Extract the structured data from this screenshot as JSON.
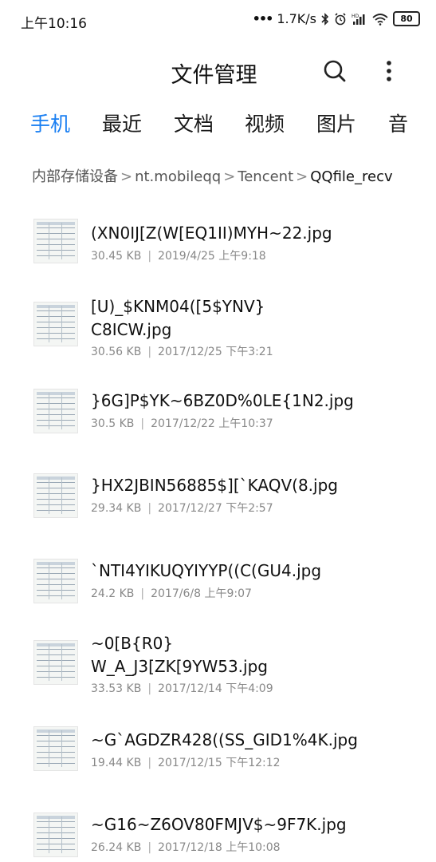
{
  "status_bar": {
    "time": "上午10:16",
    "network_speed": "1.7K/s",
    "battery": "80",
    "icons": [
      "dots-icon",
      "bluetooth-icon",
      "alarm-icon",
      "hd-signal-icon",
      "wifi-icon",
      "battery-icon"
    ]
  },
  "app_bar": {
    "title": "文件管理",
    "search_icon": "search-icon",
    "more_icon": "more-vertical-icon"
  },
  "tabs": [
    {
      "label": "手机",
      "active": true
    },
    {
      "label": "最近",
      "active": false
    },
    {
      "label": "文档",
      "active": false
    },
    {
      "label": "视频",
      "active": false
    },
    {
      "label": "图片",
      "active": false
    },
    {
      "label": "音",
      "active": false
    }
  ],
  "breadcrumb": {
    "segments": [
      "内部存储设备",
      "nt.mobileqq",
      "Tencent"
    ],
    "current": "QQfile_recv",
    "separator": ">"
  },
  "accent_color": "#1a7ff2",
  "files": [
    {
      "name": "(XN0IJ[Z(W[EQ1II)MYH~22.jpg",
      "size": "30.45 KB",
      "date": "2019/4/25 上午9:18"
    },
    {
      "name": "[U)_$KNM04([5$YNV}C8ICW.jpg",
      "name_line1": "[U)_$KNM04([5$YNV}",
      "name_line2": "C8ICW.jpg",
      "size": "30.56 KB",
      "date": "2017/12/25 下午3:21"
    },
    {
      "name": "}6G]P$YK~6BZ0D%0LE{1N2.jpg",
      "size": "30.5 KB",
      "date": "2017/12/22 上午10:37"
    },
    {
      "name": "}HX2JBIN56885$][`KAQV(8.jpg",
      "size": "29.34 KB",
      "date": "2017/12/27 下午2:57"
    },
    {
      "name": "`NTI4YIKUQYIYYP((C(GU4.jpg",
      "size": "24.2 KB",
      "date": "2017/6/8 上午9:07"
    },
    {
      "name": "~0[B{R0}W_A_J3[ZK[9YW53.jpg",
      "name_line1": "~0[B{R0}",
      "name_line2": "W_A_J3[ZK[9YW53.jpg",
      "size": "33.53 KB",
      "date": "2017/12/14 下午4:09"
    },
    {
      "name": "~G`AGDZR428((SS_GID1%4K.jpg",
      "size": "19.44 KB",
      "date": "2017/12/15 下午12:12"
    },
    {
      "name": "~G16~Z6OV80FMJV$~9F7K.jpg",
      "size": "26.24 KB",
      "date": "2017/12/18 上午10:08"
    }
  ]
}
